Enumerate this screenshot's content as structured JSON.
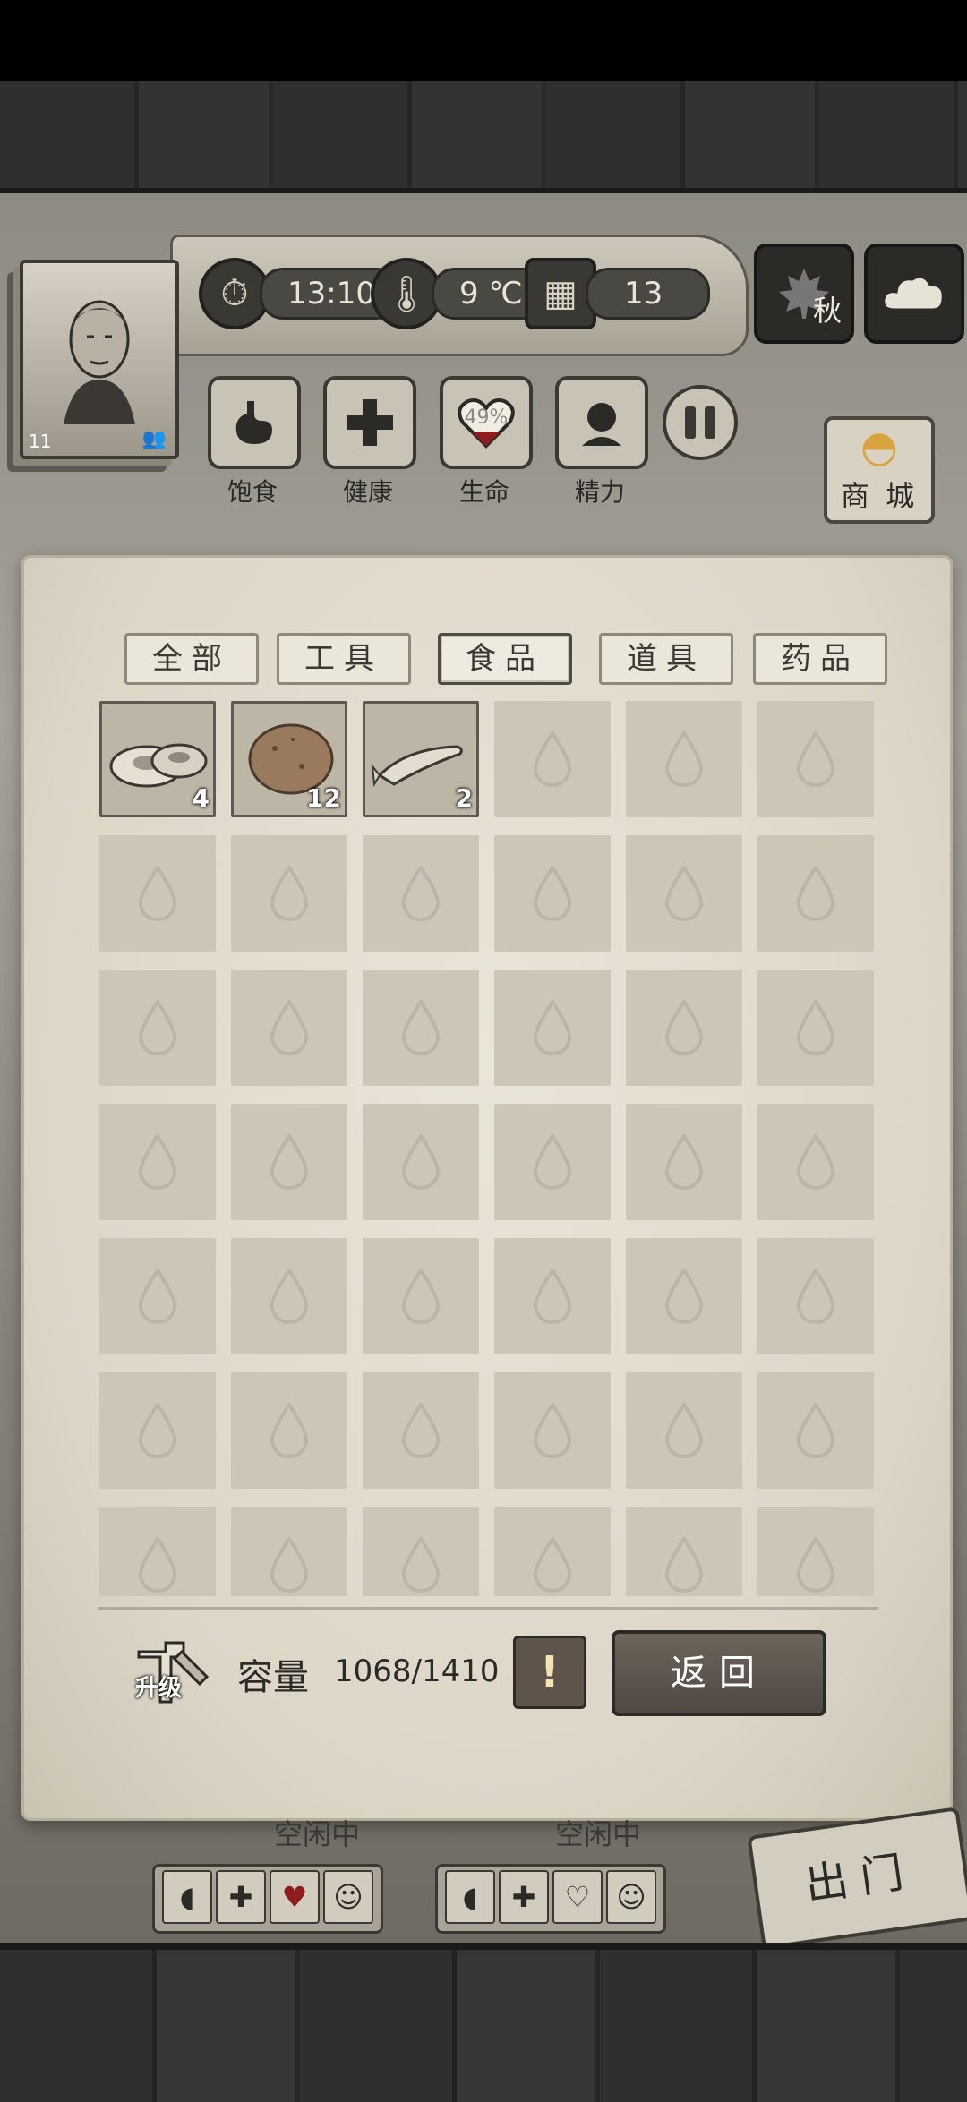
{
  "header": {
    "level": "11",
    "time": "13:10",
    "temperature": "9 ℃",
    "day": "13",
    "season": "秋"
  },
  "attributes": [
    {
      "label": "饱食",
      "icon": "stomach-icon"
    },
    {
      "label": "健康",
      "icon": "cross-icon"
    },
    {
      "label": "生命",
      "icon": "heart-icon",
      "percent": "49%"
    },
    {
      "label": "精力",
      "icon": "person-icon"
    }
  ],
  "shop_label": "商 城",
  "inventory": {
    "tabs": [
      "全部",
      "工具",
      "食品",
      "道具",
      "药品"
    ],
    "active_tab": 2,
    "items": [
      {
        "name": "mushroom-item",
        "qty": "4"
      },
      {
        "name": "potato-item",
        "qty": "12"
      },
      {
        "name": "fish-item",
        "qty": "2"
      }
    ],
    "capacity_label": "容量",
    "capacity_value": "1068/1410",
    "upgrade_label": "升级",
    "warning_label": "!",
    "back_label": "返回"
  },
  "survivors": [
    {
      "status": "空闲中"
    },
    {
      "status": "空闲中"
    }
  ],
  "go_out_label": "出门"
}
